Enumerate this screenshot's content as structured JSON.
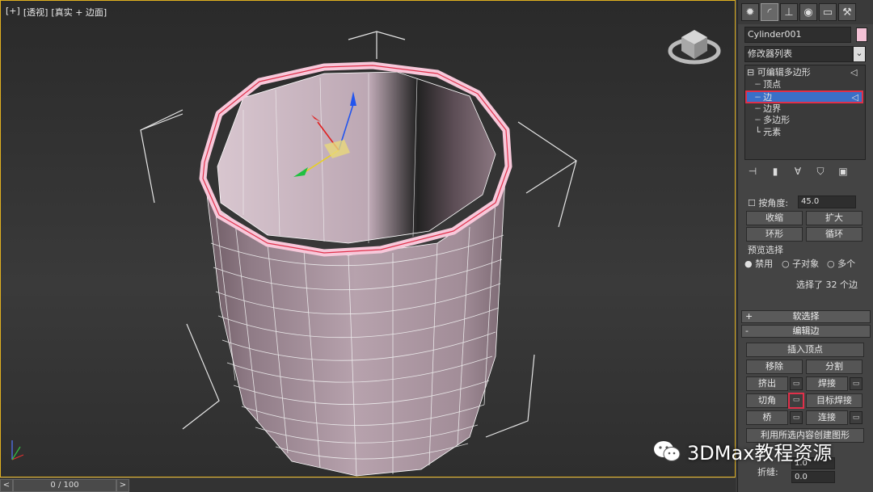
{
  "viewport": {
    "label_parts": [
      "[+]",
      "[透视]",
      "[真实 + 边面]"
    ]
  },
  "timeline": {
    "left_arrow": "<",
    "frame": "0 / 100",
    "right_arrow": ">"
  },
  "command_panel": {
    "tabs": [
      "create-icon",
      "modify-icon",
      "hierarchy-icon",
      "motion-icon",
      "display-icon",
      "utilities-icon"
    ],
    "object_name": "Cylinder001",
    "object_color": "#f4c2d6",
    "modifier_list": "修改器列表",
    "stack": {
      "root": "可编辑多边形",
      "items": [
        "顶点",
        "边",
        "边界",
        "多边形",
        "元素"
      ],
      "selected": "边"
    },
    "selection": {
      "by_angle_label": "按角度:",
      "angle_value": "45.0",
      "shrink": "收缩",
      "grow": "扩大",
      "ring": "环形",
      "loop": "循环",
      "preview_group": "预览选择",
      "preview_options": [
        "禁用",
        "子对象",
        "多个"
      ],
      "status": "选择了 32 个边"
    },
    "soft_selection": "软选择",
    "edit_edges": {
      "title": "编辑边",
      "insert_vertex": "插入顶点",
      "remove": "移除",
      "split": "分割",
      "extrude": "挤出",
      "weld": "焊接",
      "chamfer": "切角",
      "target_weld": "目标焊接",
      "bridge": "桥",
      "connect": "连接",
      "create_shape": "利用所选内容创建图形",
      "crease_label": "折缝:",
      "weight_value": "1.0",
      "crease_value": "0.0"
    }
  },
  "watermark": "3DMax教程资源",
  "accent": "#e0304a",
  "highlight": "#3a6fc8"
}
